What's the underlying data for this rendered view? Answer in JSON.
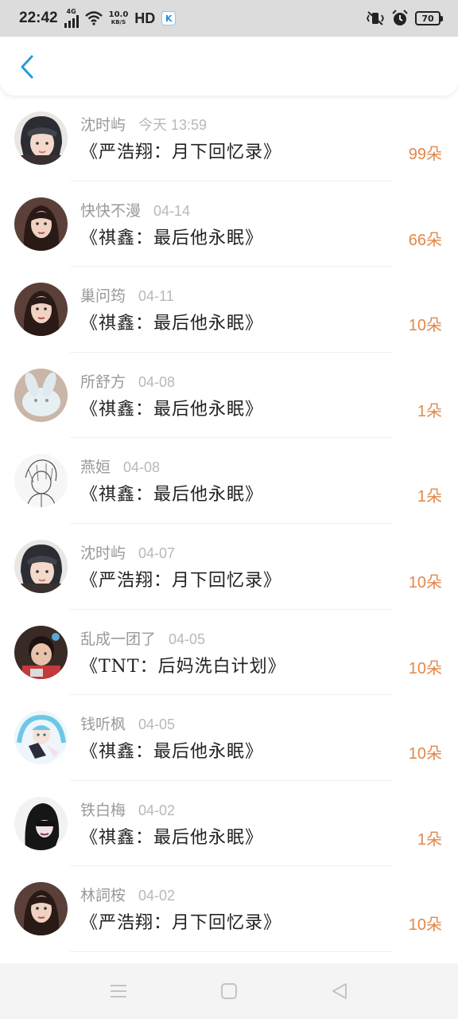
{
  "status_bar": {
    "time": "22:42",
    "network": "4G",
    "speed": "10.0",
    "speed_unit": "KB/S",
    "hd": "HD",
    "app_badge": "K",
    "battery": "70"
  },
  "header": {
    "back_icon": "chevron-left-icon",
    "accent_color": "#2a9ad8"
  },
  "colors": {
    "count": "#e2884a",
    "name": "#999999",
    "book": "#222222"
  },
  "items": [
    {
      "name": "沈时屿",
      "time": "今天 13:59",
      "book": "《严浩翔：月下回忆录》",
      "count": "99朵",
      "avatar": "helmet-girl-avatar"
    },
    {
      "name": "快快不漫",
      "time": "04-14",
      "book": "《祺鑫：最后他永眠》",
      "count": "66朵",
      "avatar": "girl-portrait-avatar"
    },
    {
      "name": "巢问筠",
      "time": "04-11",
      "book": "《祺鑫：最后他永眠》",
      "count": "10朵",
      "avatar": "girl-portrait-avatar"
    },
    {
      "name": "所舒方",
      "time": "04-08",
      "book": "《祺鑫：最后他永眠》",
      "count": "1朵",
      "avatar": "rabbit-toy-avatar"
    },
    {
      "name": "燕姮",
      "time": "04-08",
      "book": "《祺鑫：最后他永眠》",
      "count": "1朵",
      "avatar": "sketch-avatar"
    },
    {
      "name": "沈时屿",
      "time": "04-07",
      "book": "《严浩翔：月下回忆录》",
      "count": "10朵",
      "avatar": "helmet-girl-avatar"
    },
    {
      "name": "乱成一团了",
      "time": "04-05",
      "book": "《TNT：后妈洗白计划》",
      "count": "10朵",
      "avatar": "boy-avatar"
    },
    {
      "name": "钱听枫",
      "time": "04-05",
      "book": "《祺鑫：最后他永眠》",
      "count": "10朵",
      "avatar": "anime-girl-avatar"
    },
    {
      "name": "铁白梅",
      "time": "04-02",
      "book": "《祺鑫：最后他永眠》",
      "count": "1朵",
      "avatar": "dark-hair-avatar"
    },
    {
      "name": "林詞桉",
      "time": "04-02",
      "book": "《严浩翔：月下回忆录》",
      "count": "10朵",
      "avatar": "girl-portrait-avatar"
    }
  ],
  "navbar": {
    "menu_icon": "menu-icon",
    "home_icon": "home-square-icon",
    "back_icon": "back-triangle-icon"
  }
}
